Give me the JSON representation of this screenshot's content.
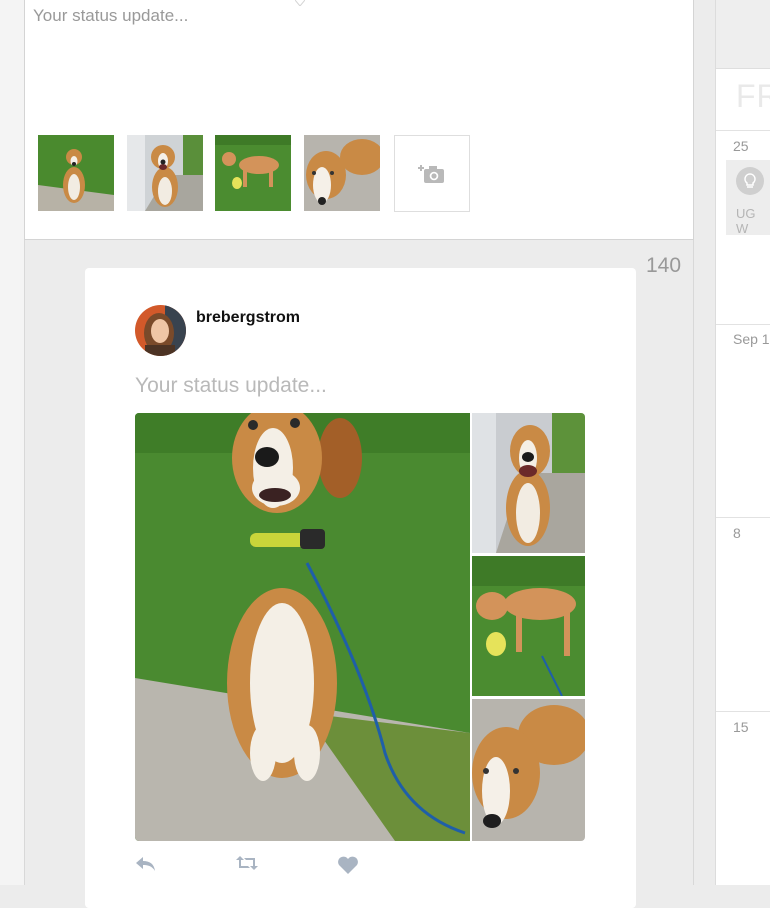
{
  "composer": {
    "placeholder": "Your status update...",
    "thumbnails": [
      {
        "icon": "dog-sitting-photo"
      },
      {
        "icon": "dog-smiling-photo"
      },
      {
        "icon": "dog-standing-photo"
      },
      {
        "icon": "dog-lying-photo"
      }
    ],
    "add_photo_icon": "camera-plus-icon"
  },
  "preview": {
    "char_count": "140",
    "username": "brebergstrom",
    "status_placeholder": "Your status update...",
    "actions": [
      "reply-icon",
      "retweet-icon",
      "like-icon"
    ]
  },
  "calendar": {
    "day_name": "FR",
    "dates": [
      "25",
      "Sep 1",
      "8",
      "15"
    ],
    "event_label": "UG W"
  },
  "colors": {
    "panel_bg": "#ececec",
    "card_bg": "#ffffff",
    "muted_text": "#999999",
    "action_icon": "#a9b4c2"
  }
}
